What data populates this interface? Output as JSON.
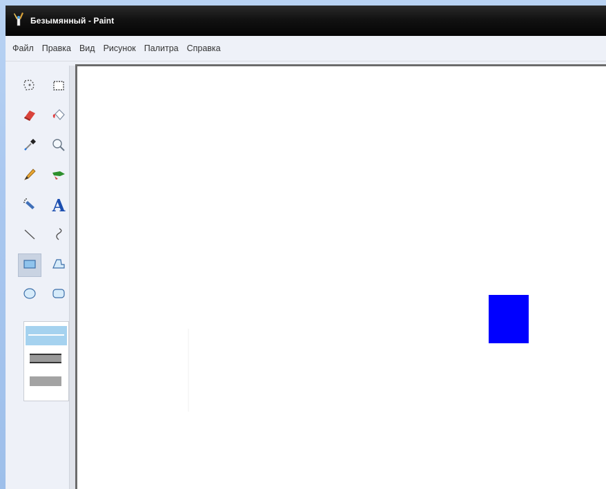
{
  "window": {
    "title": "Безымянный - Paint"
  },
  "menu": {
    "items": [
      "Файл",
      "Правка",
      "Вид",
      "Рисунок",
      "Палитра",
      "Справка"
    ]
  },
  "tools": [
    {
      "name": "free-select",
      "icon": "free-form-select-icon"
    },
    {
      "name": "rect-select",
      "icon": "rectangle-select-icon"
    },
    {
      "name": "eraser",
      "icon": "eraser-icon"
    },
    {
      "name": "fill",
      "icon": "fill-bucket-icon"
    },
    {
      "name": "pick-color",
      "icon": "color-picker-icon"
    },
    {
      "name": "magnifier",
      "icon": "magnifier-icon"
    },
    {
      "name": "pencil",
      "icon": "pencil-icon"
    },
    {
      "name": "brush",
      "icon": "brush-icon"
    },
    {
      "name": "airbrush",
      "icon": "airbrush-icon"
    },
    {
      "name": "text",
      "icon": "text-icon",
      "label": "A"
    },
    {
      "name": "line",
      "icon": "line-icon"
    },
    {
      "name": "curve",
      "icon": "curve-icon"
    },
    {
      "name": "rectangle",
      "icon": "rectangle-icon",
      "selected": true
    },
    {
      "name": "polygon",
      "icon": "polygon-icon"
    },
    {
      "name": "ellipse",
      "icon": "ellipse-icon"
    },
    {
      "name": "rounded-rectangle",
      "icon": "rounded-rectangle-icon"
    }
  ],
  "canvas": {
    "shape_color": "#0000ff"
  },
  "colors": {
    "titlebar": "#121212",
    "menu_bg": "#eef1f8",
    "canvas_bg": "#ffffff"
  }
}
